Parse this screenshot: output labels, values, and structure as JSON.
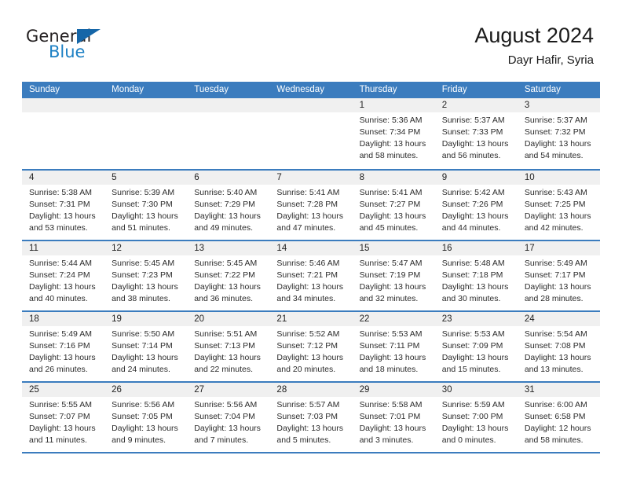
{
  "brand": {
    "name_top": "General",
    "name_bottom": "Blue",
    "logo_icon": "blue-triangle-flag-icon",
    "color_blue": "#1d80c4",
    "color_dark": "#231f20"
  },
  "header": {
    "title": "August 2024",
    "subtitle": "Dayr Hafir, Syria"
  },
  "colors": {
    "header_blue": "#3b7cbe",
    "daynum_band": "#f0f0f0",
    "text": "#2b2b2b"
  },
  "weekdays": [
    "Sunday",
    "Monday",
    "Tuesday",
    "Wednesday",
    "Thursday",
    "Friday",
    "Saturday"
  ],
  "weeks": [
    [
      {
        "day": "",
        "sunrise": "",
        "sunset": "",
        "daylight1": "",
        "daylight2": ""
      },
      {
        "day": "",
        "sunrise": "",
        "sunset": "",
        "daylight1": "",
        "daylight2": ""
      },
      {
        "day": "",
        "sunrise": "",
        "sunset": "",
        "daylight1": "",
        "daylight2": ""
      },
      {
        "day": "",
        "sunrise": "",
        "sunset": "",
        "daylight1": "",
        "daylight2": ""
      },
      {
        "day": "1",
        "sunrise": "Sunrise: 5:36 AM",
        "sunset": "Sunset: 7:34 PM",
        "daylight1": "Daylight: 13 hours",
        "daylight2": "and 58 minutes."
      },
      {
        "day": "2",
        "sunrise": "Sunrise: 5:37 AM",
        "sunset": "Sunset: 7:33 PM",
        "daylight1": "Daylight: 13 hours",
        "daylight2": "and 56 minutes."
      },
      {
        "day": "3",
        "sunrise": "Sunrise: 5:37 AM",
        "sunset": "Sunset: 7:32 PM",
        "daylight1": "Daylight: 13 hours",
        "daylight2": "and 54 minutes."
      }
    ],
    [
      {
        "day": "4",
        "sunrise": "Sunrise: 5:38 AM",
        "sunset": "Sunset: 7:31 PM",
        "daylight1": "Daylight: 13 hours",
        "daylight2": "and 53 minutes."
      },
      {
        "day": "5",
        "sunrise": "Sunrise: 5:39 AM",
        "sunset": "Sunset: 7:30 PM",
        "daylight1": "Daylight: 13 hours",
        "daylight2": "and 51 minutes."
      },
      {
        "day": "6",
        "sunrise": "Sunrise: 5:40 AM",
        "sunset": "Sunset: 7:29 PM",
        "daylight1": "Daylight: 13 hours",
        "daylight2": "and 49 minutes."
      },
      {
        "day": "7",
        "sunrise": "Sunrise: 5:41 AM",
        "sunset": "Sunset: 7:28 PM",
        "daylight1": "Daylight: 13 hours",
        "daylight2": "and 47 minutes."
      },
      {
        "day": "8",
        "sunrise": "Sunrise: 5:41 AM",
        "sunset": "Sunset: 7:27 PM",
        "daylight1": "Daylight: 13 hours",
        "daylight2": "and 45 minutes."
      },
      {
        "day": "9",
        "sunrise": "Sunrise: 5:42 AM",
        "sunset": "Sunset: 7:26 PM",
        "daylight1": "Daylight: 13 hours",
        "daylight2": "and 44 minutes."
      },
      {
        "day": "10",
        "sunrise": "Sunrise: 5:43 AM",
        "sunset": "Sunset: 7:25 PM",
        "daylight1": "Daylight: 13 hours",
        "daylight2": "and 42 minutes."
      }
    ],
    [
      {
        "day": "11",
        "sunrise": "Sunrise: 5:44 AM",
        "sunset": "Sunset: 7:24 PM",
        "daylight1": "Daylight: 13 hours",
        "daylight2": "and 40 minutes."
      },
      {
        "day": "12",
        "sunrise": "Sunrise: 5:45 AM",
        "sunset": "Sunset: 7:23 PM",
        "daylight1": "Daylight: 13 hours",
        "daylight2": "and 38 minutes."
      },
      {
        "day": "13",
        "sunrise": "Sunrise: 5:45 AM",
        "sunset": "Sunset: 7:22 PM",
        "daylight1": "Daylight: 13 hours",
        "daylight2": "and 36 minutes."
      },
      {
        "day": "14",
        "sunrise": "Sunrise: 5:46 AM",
        "sunset": "Sunset: 7:21 PM",
        "daylight1": "Daylight: 13 hours",
        "daylight2": "and 34 minutes."
      },
      {
        "day": "15",
        "sunrise": "Sunrise: 5:47 AM",
        "sunset": "Sunset: 7:19 PM",
        "daylight1": "Daylight: 13 hours",
        "daylight2": "and 32 minutes."
      },
      {
        "day": "16",
        "sunrise": "Sunrise: 5:48 AM",
        "sunset": "Sunset: 7:18 PM",
        "daylight1": "Daylight: 13 hours",
        "daylight2": "and 30 minutes."
      },
      {
        "day": "17",
        "sunrise": "Sunrise: 5:49 AM",
        "sunset": "Sunset: 7:17 PM",
        "daylight1": "Daylight: 13 hours",
        "daylight2": "and 28 minutes."
      }
    ],
    [
      {
        "day": "18",
        "sunrise": "Sunrise: 5:49 AM",
        "sunset": "Sunset: 7:16 PM",
        "daylight1": "Daylight: 13 hours",
        "daylight2": "and 26 minutes."
      },
      {
        "day": "19",
        "sunrise": "Sunrise: 5:50 AM",
        "sunset": "Sunset: 7:14 PM",
        "daylight1": "Daylight: 13 hours",
        "daylight2": "and 24 minutes."
      },
      {
        "day": "20",
        "sunrise": "Sunrise: 5:51 AM",
        "sunset": "Sunset: 7:13 PM",
        "daylight1": "Daylight: 13 hours",
        "daylight2": "and 22 minutes."
      },
      {
        "day": "21",
        "sunrise": "Sunrise: 5:52 AM",
        "sunset": "Sunset: 7:12 PM",
        "daylight1": "Daylight: 13 hours",
        "daylight2": "and 20 minutes."
      },
      {
        "day": "22",
        "sunrise": "Sunrise: 5:53 AM",
        "sunset": "Sunset: 7:11 PM",
        "daylight1": "Daylight: 13 hours",
        "daylight2": "and 18 minutes."
      },
      {
        "day": "23",
        "sunrise": "Sunrise: 5:53 AM",
        "sunset": "Sunset: 7:09 PM",
        "daylight1": "Daylight: 13 hours",
        "daylight2": "and 15 minutes."
      },
      {
        "day": "24",
        "sunrise": "Sunrise: 5:54 AM",
        "sunset": "Sunset: 7:08 PM",
        "daylight1": "Daylight: 13 hours",
        "daylight2": "and 13 minutes."
      }
    ],
    [
      {
        "day": "25",
        "sunrise": "Sunrise: 5:55 AM",
        "sunset": "Sunset: 7:07 PM",
        "daylight1": "Daylight: 13 hours",
        "daylight2": "and 11 minutes."
      },
      {
        "day": "26",
        "sunrise": "Sunrise: 5:56 AM",
        "sunset": "Sunset: 7:05 PM",
        "daylight1": "Daylight: 13 hours",
        "daylight2": "and 9 minutes."
      },
      {
        "day": "27",
        "sunrise": "Sunrise: 5:56 AM",
        "sunset": "Sunset: 7:04 PM",
        "daylight1": "Daylight: 13 hours",
        "daylight2": "and 7 minutes."
      },
      {
        "day": "28",
        "sunrise": "Sunrise: 5:57 AM",
        "sunset": "Sunset: 7:03 PM",
        "daylight1": "Daylight: 13 hours",
        "daylight2": "and 5 minutes."
      },
      {
        "day": "29",
        "sunrise": "Sunrise: 5:58 AM",
        "sunset": "Sunset: 7:01 PM",
        "daylight1": "Daylight: 13 hours",
        "daylight2": "and 3 minutes."
      },
      {
        "day": "30",
        "sunrise": "Sunrise: 5:59 AM",
        "sunset": "Sunset: 7:00 PM",
        "daylight1": "Daylight: 13 hours",
        "daylight2": "and 0 minutes."
      },
      {
        "day": "31",
        "sunrise": "Sunrise: 6:00 AM",
        "sunset": "Sunset: 6:58 PM",
        "daylight1": "Daylight: 12 hours",
        "daylight2": "and 58 minutes."
      }
    ]
  ]
}
